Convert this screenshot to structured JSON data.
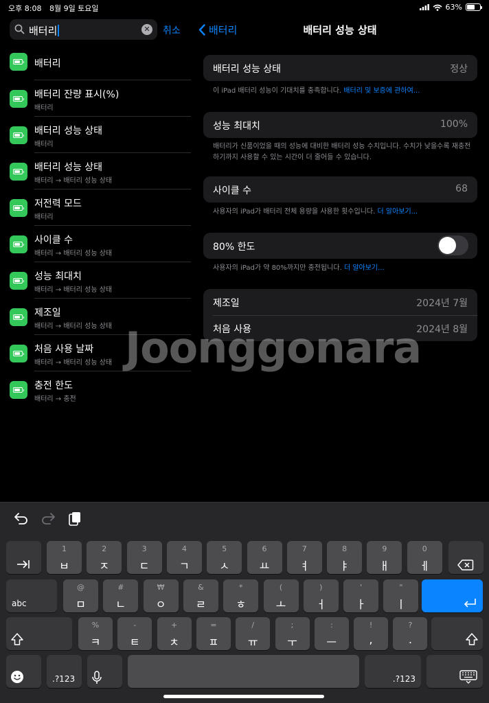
{
  "status": {
    "time": "오후 8:08",
    "date": "8월 9일 토요일",
    "battery": "63%"
  },
  "search": {
    "query": "배터리",
    "cancel": "취소"
  },
  "results": [
    {
      "title": "배터리",
      "sub": ""
    },
    {
      "title": "배터리 잔량 표시(%)",
      "sub": "배터리"
    },
    {
      "title": "배터리 성능 상태",
      "sub": "배터리"
    },
    {
      "title": "배터리 성능 상태",
      "sub": "배터리 → 배터리 성능 상태"
    },
    {
      "title": "저전력 모드",
      "sub": "배터리"
    },
    {
      "title": "사이클 수",
      "sub": "배터리 → 배터리 성능 상태"
    },
    {
      "title": "성능 최대치",
      "sub": "배터리 → 배터리 성능 상태"
    },
    {
      "title": "제조일",
      "sub": "배터리 → 배터리 성능 상태"
    },
    {
      "title": "처음 사용 날짜",
      "sub": "배터리 → 배터리 성능 상태"
    },
    {
      "title": "충전 한도",
      "sub": "배터리 → 충전"
    }
  ],
  "nav": {
    "back": "배터리",
    "title": "배터리 성능 상태"
  },
  "health": {
    "label": "배터리 성능 상태",
    "value": "정상",
    "note": "이 iPad 배터리 성능이 기대치를 충족합니다.",
    "note_link": "배터리 및 보증에 관하여..."
  },
  "capacity": {
    "label": "성능 최대치",
    "value": "100%",
    "note": "배터리가 신품이었을 때의 성능에 대비한 배터리 성능 수치입니다. 수치가 낮을수록 재충전하기까지 사용할 수 있는 시간이 더 줄어들 수 있습니다."
  },
  "cycles": {
    "label": "사이클 수",
    "value": "68",
    "note": "사용자의 iPad가 배터리 전체 용량을 사용한 횟수입니다.",
    "note_link": "더 알아보기..."
  },
  "limit": {
    "label": "80% 한도",
    "on": false,
    "note": "사용자의 iPad가 약 80%까지만 충전됩니다.",
    "note_link": "더 알아보기..."
  },
  "dates": {
    "manufactured_label": "제조일",
    "manufactured_value": "2024년 7월",
    "first_use_label": "처음 사용",
    "first_use_value": "2024년 8월"
  },
  "watermark": "Joonggonara",
  "keyboard": {
    "row1": [
      [
        "1",
        "ㅂ"
      ],
      [
        "2",
        "ㅈ"
      ],
      [
        "3",
        "ㄷ"
      ],
      [
        "4",
        "ㄱ"
      ],
      [
        "5",
        "ㅅ"
      ],
      [
        "6",
        "ㅛ"
      ],
      [
        "7",
        "ㅕ"
      ],
      [
        "8",
        "ㅑ"
      ],
      [
        "9",
        "ㅐ"
      ],
      [
        "0",
        "ㅔ"
      ]
    ],
    "row2": [
      [
        "@",
        "ㅁ"
      ],
      [
        "#",
        "ㄴ"
      ],
      [
        "₩",
        "ㅇ"
      ],
      [
        "&",
        "ㄹ"
      ],
      [
        "*",
        "ㅎ"
      ],
      [
        "(",
        "ㅗ"
      ],
      [
        ")",
        "ㅓ"
      ],
      [
        "'",
        "ㅏ"
      ],
      [
        "\"",
        "ㅣ"
      ]
    ],
    "row3": [
      [
        "%",
        "ㅋ"
      ],
      [
        "-",
        "ㅌ"
      ],
      [
        "+",
        "ㅊ"
      ],
      [
        "=",
        "ㅍ"
      ],
      [
        "/",
        "ㅠ"
      ],
      [
        ";",
        "ㅜ"
      ],
      [
        ":",
        "ㅡ"
      ],
      [
        "!",
        ","
      ],
      [
        "?",
        "."
      ]
    ],
    "abc": "abc",
    "num_left": ".?123",
    "num_right": ".?123"
  }
}
